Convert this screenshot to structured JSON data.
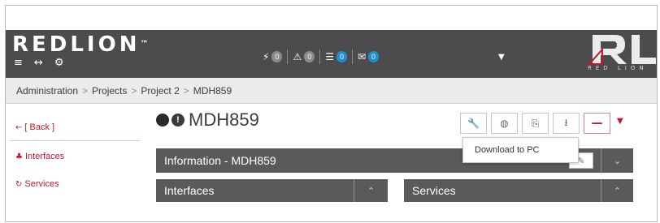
{
  "brand": {
    "name": "REDLION",
    "tm": "™",
    "rl_mark": "RL",
    "rl_text": "RED LION"
  },
  "header": {
    "counters": [
      {
        "icon": "bolt-icon",
        "glyph": "⚡",
        "value": "0",
        "color": "grey"
      },
      {
        "icon": "warning-icon",
        "glyph": "⚠",
        "value": "0",
        "color": "grey"
      },
      {
        "icon": "server-icon",
        "glyph": "☰",
        "value": "0",
        "color": "blue"
      },
      {
        "icon": "envelope-icon",
        "glyph": "✉",
        "value": "0",
        "color": "blue"
      }
    ]
  },
  "breadcrumb": {
    "items": [
      "Administration",
      "Projects",
      "Project 2",
      "MDH859"
    ],
    "separator": ">"
  },
  "sidebar": {
    "items": [
      {
        "label": "[ Back ]",
        "icon": "arrow-left-icon",
        "glyph": "←"
      },
      {
        "label": "Interfaces",
        "icon": "sitemap-icon",
        "glyph": "♣"
      },
      {
        "label": "Services",
        "icon": "refresh-icon",
        "glyph": "↻"
      }
    ]
  },
  "main": {
    "title": "MDH859",
    "toolbar": [
      {
        "name": "wrench-button",
        "icon": "wrench-icon",
        "glyph": "🔧"
      },
      {
        "name": "dashboard-button",
        "icon": "dashboard-icon",
        "glyph": "◍"
      },
      {
        "name": "copy-button",
        "icon": "copy-icon",
        "glyph": "⎘"
      },
      {
        "name": "download-button",
        "icon": "download-icon",
        "glyph": "⭳"
      },
      {
        "name": "remove-button",
        "icon": "minus-icon",
        "glyph": "—"
      }
    ],
    "tooltip": "Download to PC",
    "info_panel": "Information - MDH859",
    "interfaces_panel": "Interfaces",
    "services_panel": "Services"
  },
  "colors": {
    "accent": "#c0192d",
    "header_bg": "#4c4c4e",
    "panel_bg": "#5a5a5c",
    "badge_blue": "#1f8fd1",
    "badge_grey": "#8b8b8b"
  }
}
